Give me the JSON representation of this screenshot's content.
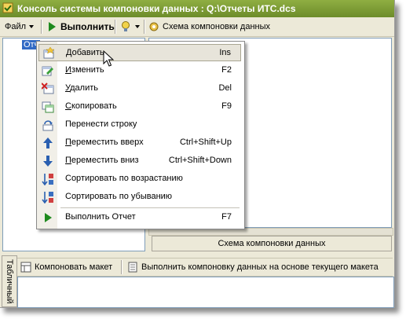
{
  "window": {
    "title": "Консоль системы компоновки данных : Q:\\Отчеты ИТС.dcs"
  },
  "toolbar": {
    "file_label": "Файл",
    "run_label": "Выполнить",
    "schema_label": "Схема компоновки данных"
  },
  "tree": {
    "selected_node": "Отч"
  },
  "right_pane": {
    "tab_label": "Схема компоновки данных"
  },
  "bottom": {
    "compose_label": "Компоновать макет",
    "execute_label": "Выполнить компоновку данных на основе текущего макета",
    "vertical_tab": "Табличный"
  },
  "menu": {
    "items": [
      {
        "label": "Добавить",
        "shortcut": "Ins",
        "icon": "add-icon"
      },
      {
        "label": "Изменить",
        "shortcut": "F2",
        "icon": "edit-icon"
      },
      {
        "label": "Удалить",
        "shortcut": "Del",
        "icon": "delete-icon"
      },
      {
        "label": "Скопировать",
        "shortcut": "F9",
        "icon": "copy-icon"
      },
      {
        "label": "Перенести строку",
        "shortcut": "",
        "icon": "move-row-icon"
      },
      {
        "label": "Переместить вверх",
        "shortcut": "Ctrl+Shift+Up",
        "icon": "arrow-up-icon"
      },
      {
        "label": "Переместить вниз",
        "shortcut": "Ctrl+Shift+Down",
        "icon": "arrow-down-icon"
      },
      {
        "label": "Сортировать по возрастанию",
        "shortcut": "",
        "icon": "sort-ascending-icon"
      },
      {
        "label": "Сортировать по убыванию",
        "shortcut": "",
        "icon": "sort-descending-icon"
      },
      {
        "label": "Выполнить Отчет",
        "shortcut": "F7",
        "icon": "run-report-icon"
      }
    ]
  },
  "colors": {
    "title_bar": "#7a9a33",
    "selection": "#316ac5",
    "menu_highlight": "#e7e4da"
  }
}
